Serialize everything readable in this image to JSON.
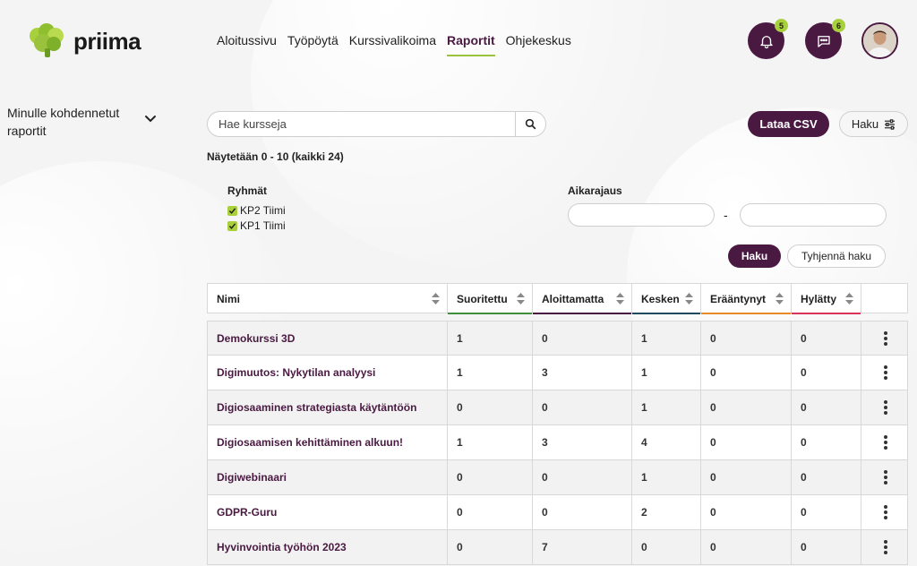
{
  "app": {
    "logo_text": "priima"
  },
  "nav": {
    "items": [
      {
        "label": "Aloitussivu",
        "active": false
      },
      {
        "label": "Työpöytä",
        "active": false
      },
      {
        "label": "Kurssivalikoima",
        "active": false
      },
      {
        "label": "Raportit",
        "active": true
      },
      {
        "label": "Ohjekeskus",
        "active": false
      }
    ]
  },
  "header": {
    "notifications": {
      "icon": "bell-icon",
      "count": "5"
    },
    "messages": {
      "icon": "chat-icon",
      "count": "6"
    }
  },
  "sidebar": {
    "title": "Minulle kohdennetut raportit"
  },
  "search": {
    "placeholder": "Hae kursseja",
    "value": ""
  },
  "toolbar": {
    "csv_label": "Lataa CSV",
    "filter_label": "Haku"
  },
  "showing": "Näytetään 0 - 10 (kaikki 24)",
  "filters": {
    "groups_label": "Ryhmät",
    "groups": [
      {
        "label": "KP2 Tiimi",
        "checked": true
      },
      {
        "label": "KP1 Tiimi",
        "checked": true
      }
    ],
    "date_label": "Aikarajaus",
    "date_from": "",
    "date_to": "",
    "date_separator": "-",
    "search_label": "Haku",
    "clear_label": "Tyhjennä haku"
  },
  "table": {
    "headers": [
      {
        "label": "Nimi"
      },
      {
        "label": "Suoritettu",
        "color": "#3e8e3e"
      },
      {
        "label": "Aloittamatta",
        "color": "#4a1942"
      },
      {
        "label": "Kesken",
        "color": "#1e4a5e"
      },
      {
        "label": "Erääntynyt",
        "color": "#e8892c"
      },
      {
        "label": "Hylätty",
        "color": "#d9335a"
      }
    ],
    "rows": [
      {
        "name": "Demokurssi 3D",
        "suoritettu": "1",
        "aloittamatta": "0",
        "kesken": "1",
        "eraantynyt": "0",
        "hylatty": "0"
      },
      {
        "name": "Digimuutos: Nykytilan analyysi",
        "suoritettu": "1",
        "aloittamatta": "3",
        "kesken": "1",
        "eraantynyt": "0",
        "hylatty": "0"
      },
      {
        "name": "Digiosaaminen strategiasta käytäntöön",
        "suoritettu": "0",
        "aloittamatta": "0",
        "kesken": "1",
        "eraantynyt": "0",
        "hylatty": "0"
      },
      {
        "name": "Digiosaamisen kehittäminen alkuun!",
        "suoritettu": "1",
        "aloittamatta": "3",
        "kesken": "4",
        "eraantynyt": "0",
        "hylatty": "0"
      },
      {
        "name": "Digiwebinaari",
        "suoritettu": "0",
        "aloittamatta": "0",
        "kesken": "1",
        "eraantynyt": "0",
        "hylatty": "0"
      },
      {
        "name": "GDPR-Guru",
        "suoritettu": "0",
        "aloittamatta": "0",
        "kesken": "2",
        "eraantynyt": "0",
        "hylatty": "0"
      },
      {
        "name": "Hyvinvointia työhön 2023",
        "suoritettu": "0",
        "aloittamatta": "7",
        "kesken": "0",
        "eraantynyt": "0",
        "hylatty": "0"
      }
    ]
  },
  "colors": {
    "brand": "#4a1942",
    "accent": "#a8cf3c"
  }
}
